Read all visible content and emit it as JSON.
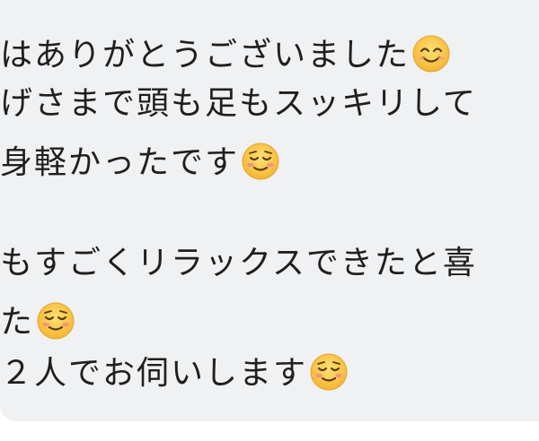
{
  "message": {
    "lines": [
      {
        "text": "はありがとうございました",
        "emoji": "smiling-face-with-smiling-eyes"
      },
      {
        "text": "げさまで頭も足もスッキリして",
        "emoji": ""
      },
      {
        "text": "身軽かったです",
        "emoji": "relieved-blushing-face"
      },
      {
        "text": "",
        "emoji": ""
      },
      {
        "text": "もすごくリラックスできたと喜",
        "emoji": ""
      },
      {
        "text": "た",
        "emoji": "relieved-blushing-face"
      },
      {
        "text": "２人でお伺いします",
        "emoji": "relieved-blushing-face"
      }
    ]
  },
  "colors": {
    "bubble_background": "#f0f1f3",
    "text": "#1f1f1f",
    "emoji_face": "#f8c33a"
  }
}
